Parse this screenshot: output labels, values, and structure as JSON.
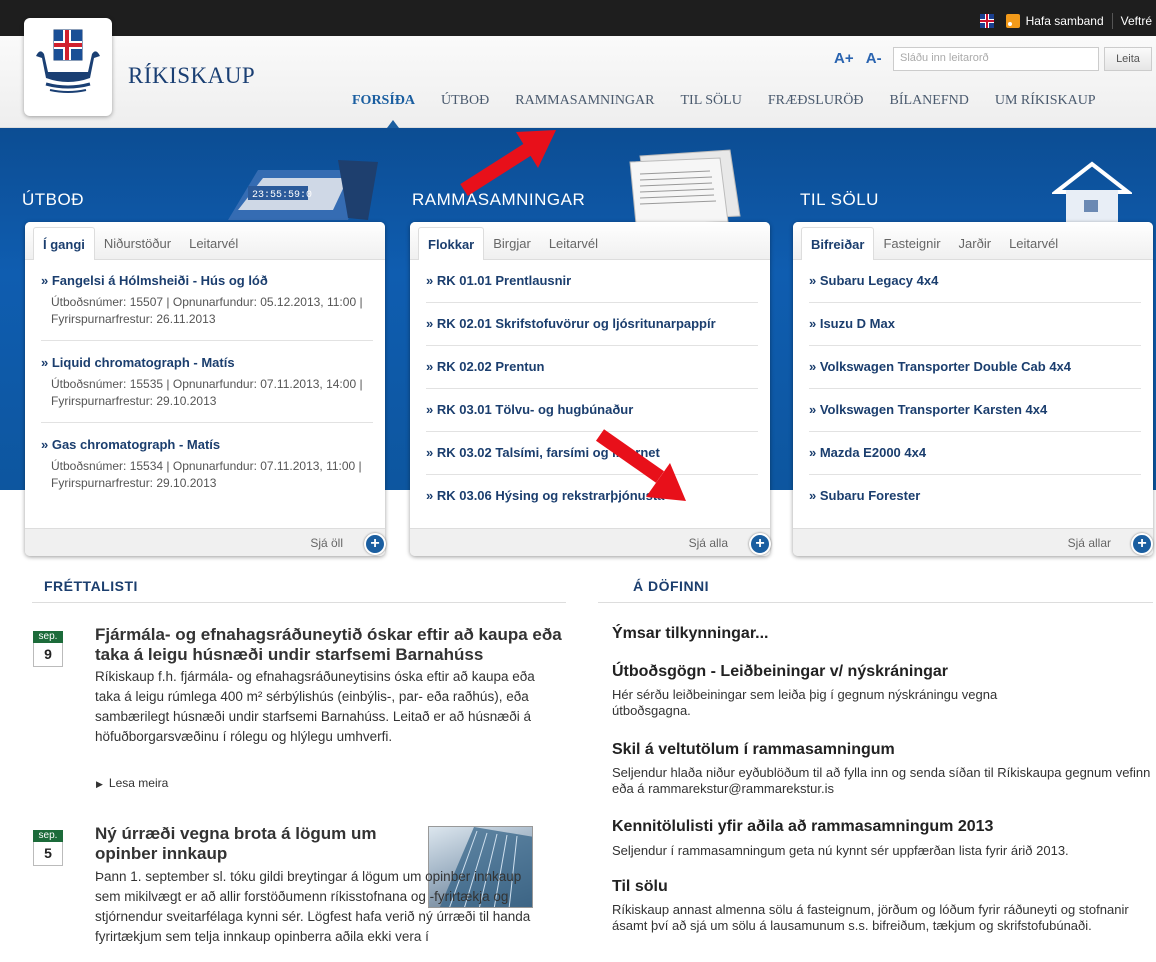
{
  "topbar": {
    "contact": "Hafa samband",
    "webmail": "Veftré"
  },
  "header": {
    "brand": "RÍKISKAUP",
    "font_increase": "A+",
    "font_decrease": "A-",
    "search_placeholder": "Sláðu inn leitarorð",
    "search_button": "Leita"
  },
  "nav": [
    "FORSÍÐA",
    "ÚTBOÐ",
    "RAMMASAMNINGAR",
    "TIL SÖLU",
    "FRÆÐSLURÖÐ",
    "BÍLANEFND",
    "UM RÍKISKAUP"
  ],
  "panels": {
    "utbod": {
      "title": "ÚTBOÐ",
      "tabs": [
        "Í gangi",
        "Niðurstöður",
        "Leitarvél"
      ],
      "items": [
        {
          "title": "» Fangelsi á Hólmsheiði - Hús og lóð",
          "meta": "Útboðsnúmer: 15507 | Opnunarfundur: 05.12.2013, 11:00 | Fyrirspurnarfrestur: 26.11.2013"
        },
        {
          "title": "» Liquid chromatograph - Matís",
          "meta": "Útboðsnúmer: 15535 | Opnunarfundur: 07.11.2013, 14:00 | Fyrirspurnarfrestur: 29.10.2013"
        },
        {
          "title": "» Gas chromatograph - Matís",
          "meta": "Útboðsnúmer: 15534 | Opnunarfundur: 07.11.2013, 11:00 | Fyrirspurnarfrestur: 29.10.2013"
        }
      ],
      "footer": "Sjá öll",
      "image_text": "23:55:59:0"
    },
    "ramma": {
      "title": "RAMMASAMNINGAR",
      "tabs": [
        "Flokkar",
        "Birgjar",
        "Leitarvél"
      ],
      "items": [
        "» RK 01.01 Prentlausnir",
        "» RK 02.01 Skrifstofuvörur og ljósritunarpappír",
        "» RK 02.02 Prentun",
        "» RK 03.01 Tölvu- og hugbúnaður",
        "» RK 03.02 Talsími, farsími og internet",
        "» RK 03.06 Hýsing og rekstrarþjónusta"
      ],
      "footer": "Sjá alla"
    },
    "tilsolu": {
      "title": "TIL SÖLU",
      "tabs": [
        "Bifreiðar",
        "Fasteignir",
        "Jarðir",
        "Leitarvél"
      ],
      "items": [
        "» Subaru Legacy 4x4",
        "» Isuzu D Max",
        "» Volkswagen Transporter Double Cab 4x4",
        "» Volkswagen Transporter Karsten 4x4",
        "» Mazda E2000 4x4",
        "» Subaru Forester"
      ],
      "footer": "Sjá allar"
    }
  },
  "news": {
    "heading": "FRÉTTALISTI",
    "items": [
      {
        "month": "sep.",
        "day": "9",
        "title": "Fjármála- og efnahagsráðuneytið óskar eftir að kaupa eða taka á leigu húsnæði undir starfsemi Barnahúss",
        "body": "Ríkiskaup f.h. fjármála- og efnahagsráðuneytisins óska eftir að kaupa eða taka á leigu rúmlega 400 m² sérbýlishús (einbýlis-, par- eða raðhús), eða sambærilegt húsnæði undir starfsemi Barnahúss. Leitað er að húsnæði á höfuðborgarsvæðinu í rólegu og hlýlegu umhverfi.",
        "more": "Lesa meira"
      },
      {
        "month": "sep.",
        "day": "5",
        "title": "Ný úrræði vegna brota á lögum um opinber innkaup",
        "body": "Þann 1. september sl. tóku gildi breytingar á lögum um opinber innkaup sem mikilvægt er að allir forstöðumenn ríkisstofnana og -fyrirtækja og stjórnendur sveitarfélaga kynni sér. Lögfest hafa verið ný úrræði til handa fyrirtækjum sem telja innkaup opinberra aðila ekki vera í"
      }
    ]
  },
  "dofinni": {
    "heading": "Á DÖFINNI",
    "intro": "Ýmsar tilkynningar...",
    "items": [
      {
        "title": "Útboðsgögn - Leiðbeiningar v/ nýskráningar",
        "body": "Hér sérðu leiðbeiningar sem leiða þig í gegnum nýskráningu vegna útboðsgagna."
      },
      {
        "title": "Skil á veltutölum í rammasamningum",
        "body": "Seljendur hlaða niður eyðublöðum til að fylla inn og senda síðan til Ríkiskaupa gegnum vefinn eða á rammarekstur@rammarekstur.is"
      },
      {
        "title": "Kennitölulisti yfir aðila að rammasamningum 2013",
        "body": "Seljendur í rammasamningum geta nú kynnt sér uppfærðan lista fyrir árið 2013."
      },
      {
        "title": "Til sölu",
        "body": "Ríkiskaup annast almenna sölu á fasteignum, jörðum og lóðum fyrir ráðuneyti og stofnanir ásamt því að sjá um sölu á lausamunum s.s. bifreiðum, tækjum og skrifstofubúnaði."
      }
    ]
  },
  "colors": {
    "accent": "#1a5ea0",
    "band": "#0f5db0",
    "annotation_arrow": "#e8101a"
  }
}
